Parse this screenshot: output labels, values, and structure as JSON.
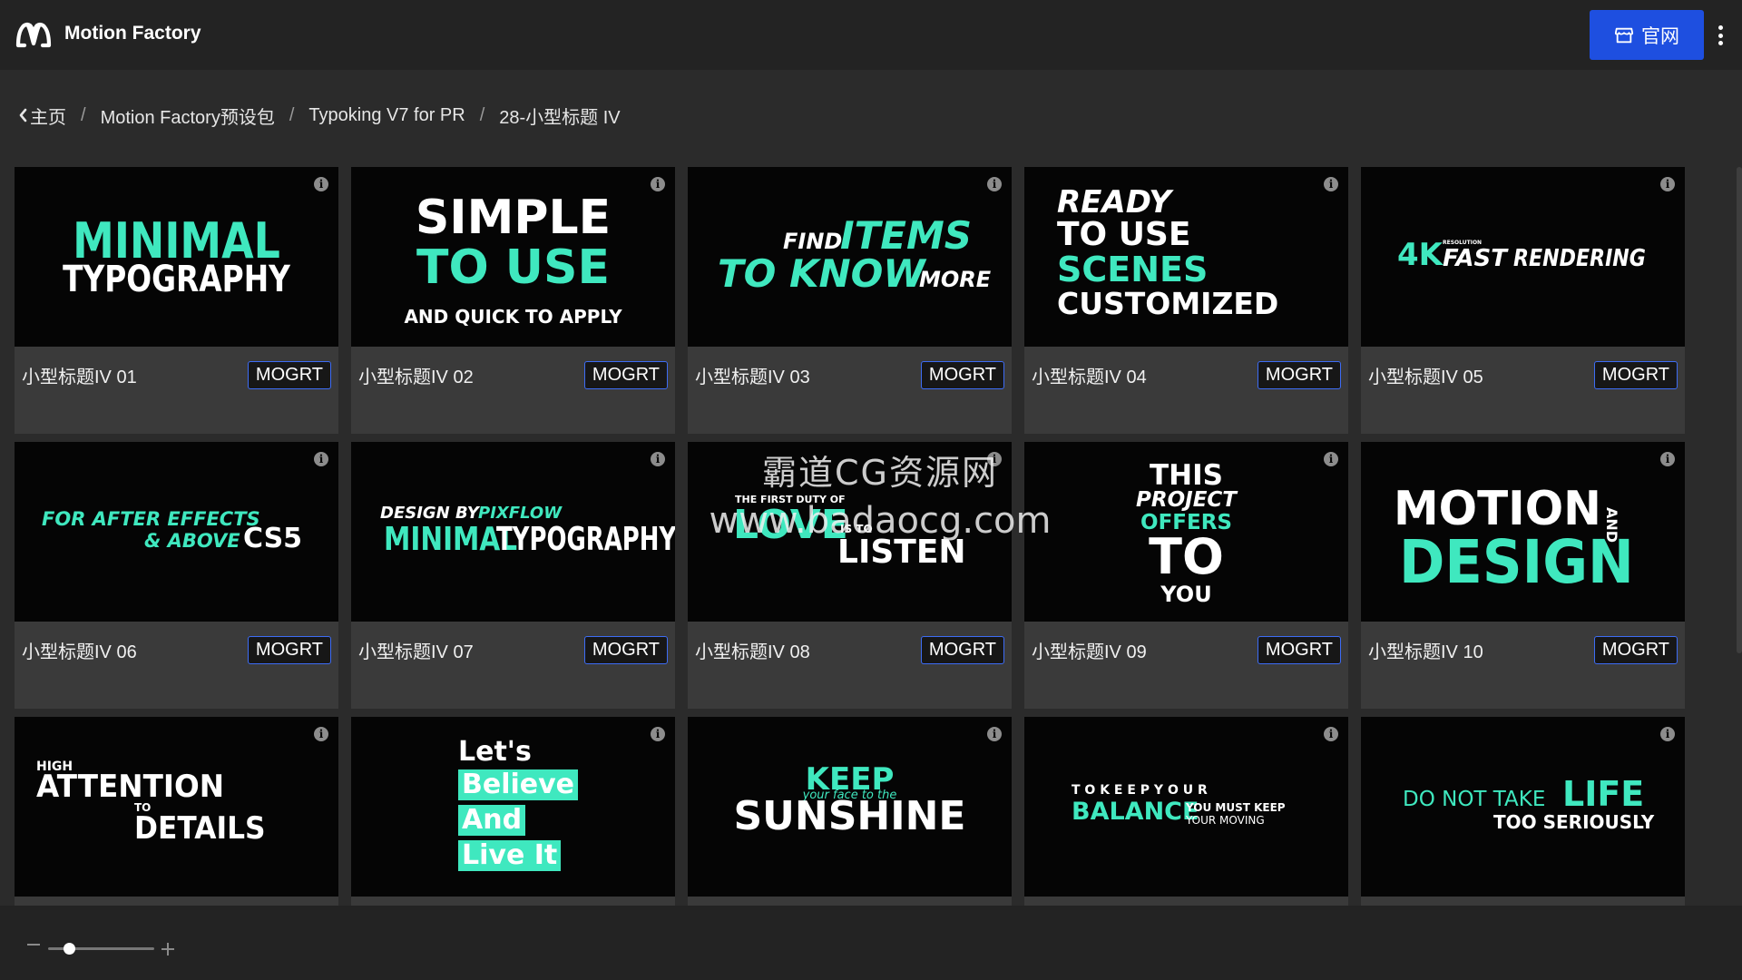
{
  "app": {
    "title": "Motion Factory",
    "site_button": "官网",
    "accent": "#1e4fe0"
  },
  "breadcrumb": [
    "主页",
    "Motion Factory预设包",
    "Typoking V7 for PR",
    "28-小型标题 IV"
  ],
  "cards": [
    {
      "label": "小型标题IV 01",
      "format": "MOGRT"
    },
    {
      "label": "小型标题IV 02",
      "format": "MOGRT"
    },
    {
      "label": "小型标题IV 03",
      "format": "MOGRT"
    },
    {
      "label": "小型标题IV 04",
      "format": "MOGRT"
    },
    {
      "label": "小型标题IV 05",
      "format": "MOGRT"
    },
    {
      "label": "小型标题IV 06",
      "format": "MOGRT"
    },
    {
      "label": "小型标题IV 07",
      "format": "MOGRT"
    },
    {
      "label": "小型标题IV 08",
      "format": "MOGRT"
    },
    {
      "label": "小型标题IV 09",
      "format": "MOGRT"
    },
    {
      "label": "小型标题IV 10",
      "format": "MOGRT"
    }
  ],
  "thumbs": {
    "t1": [
      "MINIMAL",
      "TYPOGRAPHY"
    ],
    "t2": [
      "SIMPLE",
      "TO USE",
      "AND QUICK TO APPLY"
    ],
    "t3": [
      "FIND",
      "ITEMS",
      "TO KNOW",
      "MORE"
    ],
    "t4": [
      "READY",
      "TO USE",
      "SCENES",
      "CUSTOMIZED"
    ],
    "t5": [
      "4K",
      "RESOLUTION",
      "FAST",
      "RENDERING"
    ],
    "t6": [
      "FOR AFTER EFFECTS",
      "& ABOVE",
      "CS5"
    ],
    "t7": [
      "DESIGN BY",
      "PIXFLOW",
      "MINIMAL",
      "TYPOGRAPHY"
    ],
    "t8": [
      "THE FIRST DUTY OF",
      "LOVE",
      "IS TO",
      "LISTEN"
    ],
    "t9": [
      "THIS",
      "PROJECT",
      "OFFERS",
      "TO",
      "YOU"
    ],
    "t10": [
      "MOTION",
      "AND",
      "DESIGN"
    ],
    "t11": [
      "HIGH",
      "ATTENTION",
      "TO",
      "DETAILS"
    ],
    "t12": [
      "Let's",
      "Believe",
      "And",
      "Live It"
    ],
    "t13": [
      "KEEP",
      "your face to the",
      "SUNSHINE"
    ],
    "t14": [
      "T O   K E E P   Y O U R",
      "BALANCE",
      "YOU MUST KEEP",
      "YOUR MOVING"
    ],
    "t15": [
      "DO NOT TAKE",
      "LIFE",
      "TOO SERIOUSLY"
    ]
  },
  "watermark": [
    "霸道CG资源网",
    "www.badaocg.com"
  ],
  "zoom": {
    "level": 0.2
  },
  "icons": {
    "logo": "motion-factory-logo-icon",
    "site": "storefront-icon",
    "more": "kebab-menu-icon",
    "back": "chevron-left-icon",
    "info": "info-icon"
  }
}
